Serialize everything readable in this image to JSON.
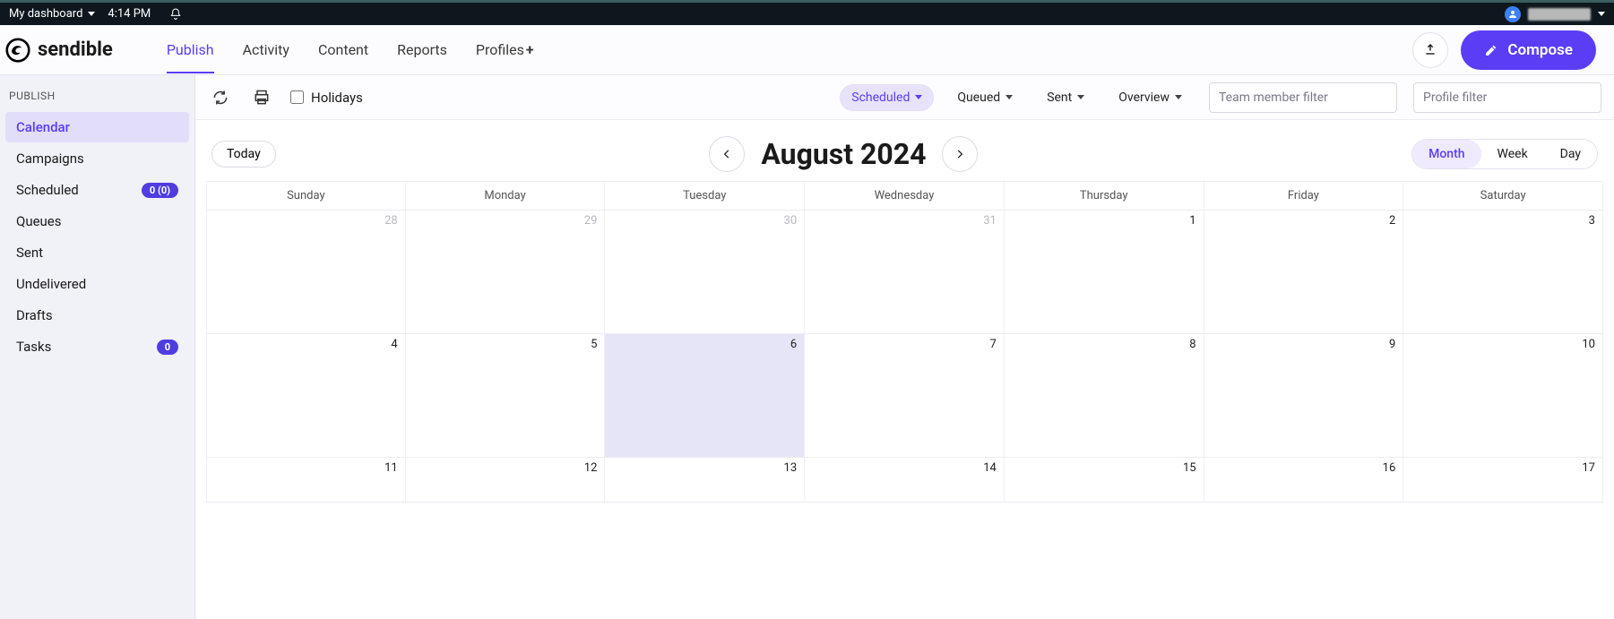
{
  "topbar": {
    "dashboard_label": "My dashboard",
    "time": "4:14 PM"
  },
  "brand": "sendible",
  "nav": {
    "publish": "Publish",
    "activity": "Activity",
    "content": "Content",
    "reports": "Reports",
    "profiles": "Profiles"
  },
  "compose_label": "Compose",
  "sidebar": {
    "heading": "PUBLISH",
    "calendar": "Calendar",
    "campaigns": "Campaigns",
    "scheduled": "Scheduled",
    "scheduled_badge": "0 (0)",
    "queues": "Queues",
    "sent": "Sent",
    "undelivered": "Undelivered",
    "drafts": "Drafts",
    "tasks": "Tasks",
    "tasks_badge": "0"
  },
  "toolbar": {
    "holidays_label": "Holidays",
    "scheduled": "Scheduled",
    "queued": "Queued",
    "sent": "Sent",
    "overview": "Overview",
    "team_filter_placeholder": "Team member filter",
    "profile_filter_placeholder": "Profile filter"
  },
  "calendar": {
    "today_label": "Today",
    "title": "August 2024",
    "view_month": "Month",
    "view_week": "Week",
    "view_day": "Day",
    "dow": [
      "Sunday",
      "Monday",
      "Tuesday",
      "Wednesday",
      "Thursday",
      "Friday",
      "Saturday"
    ],
    "weeks": [
      [
        {
          "n": "28",
          "other": true
        },
        {
          "n": "29",
          "other": true
        },
        {
          "n": "30",
          "other": true
        },
        {
          "n": "31",
          "other": true
        },
        {
          "n": "1"
        },
        {
          "n": "2"
        },
        {
          "n": "3"
        }
      ],
      [
        {
          "n": "4"
        },
        {
          "n": "5"
        },
        {
          "n": "6",
          "today": true
        },
        {
          "n": "7"
        },
        {
          "n": "8"
        },
        {
          "n": "9"
        },
        {
          "n": "10"
        }
      ],
      [
        {
          "n": "11"
        },
        {
          "n": "12"
        },
        {
          "n": "13"
        },
        {
          "n": "14"
        },
        {
          "n": "15"
        },
        {
          "n": "16"
        },
        {
          "n": "17"
        }
      ]
    ]
  }
}
